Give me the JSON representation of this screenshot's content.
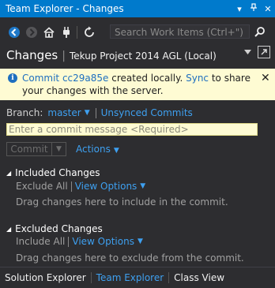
{
  "window": {
    "title": "Team Explorer - Changes",
    "dropdown_glyph": "▾",
    "pin_glyph": "⊥",
    "close_glyph": "✕"
  },
  "toolbar": {
    "icons": [
      "back-icon",
      "forward-icon",
      "home-icon",
      "connect-icon",
      "refresh-icon"
    ],
    "search_placeholder": "Search Work Items (Ctrl+\")"
  },
  "header": {
    "title": "Changes",
    "separator": "|",
    "subtitle": "Tekup Project 2014 AGL (Local)"
  },
  "infobar": {
    "link_commit": "Commit cc29a85e",
    "text_created": " created locally. ",
    "link_sync": "Sync",
    "text_rest": " to share your changes with the server.",
    "close_glyph": "✕",
    "info_glyph": "i"
  },
  "branch": {
    "label": "Branch:",
    "value": "master",
    "unsynced": "Unsynced Commits"
  },
  "commit": {
    "placeholder": "Enter a commit message <Required>",
    "button": "Commit",
    "actions": "Actions"
  },
  "included": {
    "title": "Included Changes",
    "exclude_all": "Exclude All",
    "view_options": "View Options",
    "hint": "Drag changes here to include in the commit."
  },
  "excluded": {
    "title": "Excluded Changes",
    "include_all": "Include All",
    "view_options": "View Options",
    "hint": "Drag changes here to exclude from the commit."
  },
  "bottom_tabs": [
    "Solution Explorer",
    "Team Explorer",
    "Class View"
  ],
  "colors": {
    "accent": "#007acc",
    "link": "#3ea0f0",
    "background": "#2d2d30",
    "infobar": "#fefbd3"
  }
}
